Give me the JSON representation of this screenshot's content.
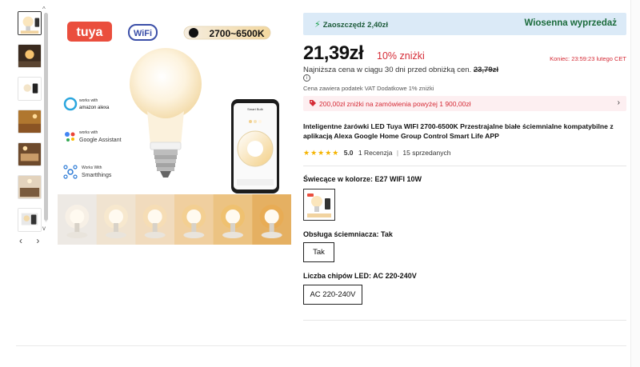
{
  "gallery": {
    "thumbnails": [
      "bulb-hero",
      "room-lamp",
      "bulb-app",
      "bedroom",
      "living-room",
      "kitchen",
      "bulb-app-2"
    ],
    "active_index": 0,
    "nav_prev": "‹",
    "nav_next": "›",
    "scroll_up": "^",
    "scroll_down": "v"
  },
  "main_image": {
    "brand_logo": "tuya",
    "wifi_badge": "WiFi",
    "temperature_range": "2700~6500K",
    "works_with_alexa_small": "works with",
    "works_with_alexa_big": "amazon alexa",
    "works_with_google_small": "works with",
    "works_with_google_big": "Google Assistant",
    "works_with_st_small": "Works With",
    "works_with_st_big": "Smartthings",
    "phone_header": "Smart Bulb",
    "bulb_colors": [
      "#fff6e8",
      "#fdeccc",
      "#f9dfae",
      "#f6cf86",
      "#f2bf63",
      "#eba94a"
    ],
    "strip_colors": [
      "#ede9e4",
      "#f0e3d0",
      "#f1dbbd",
      "#f0cf9f",
      "#ecc382",
      "#e5b062"
    ]
  },
  "price_block": {
    "save_label": "Zaoszczędź 2,40zł",
    "sale_label": "Wiosenna wyprzedaż",
    "price": "21,39zł",
    "discount": "10% zniżki",
    "ends": "Koniec: 23:59:23 lutego CET",
    "lowest_price_prefix": "Najniższa cena w ciągu 30 dni przed obniżką cen.",
    "lowest_price_value": "23,79zł",
    "info_icon": "i",
    "vat_note": "Cena zawiera podatek VAT Dodatkowe 1% zniżki",
    "promo_text": "200,00zł zniżki na zamówienia powyżej 1 900,00zł",
    "promo_chevron": "›"
  },
  "product": {
    "title": "Inteligentne żarówki LED Tuya WIFI 2700-6500K Przestrajalne białe ściemnialne kompatybilne z aplikacją Alexa Google Home Group Control Smart Life APP",
    "stars": "★★★★★",
    "rating": "5.0",
    "reviews": "1 Recenzja",
    "sold": "15 sprzedanych",
    "separator": "|"
  },
  "options": {
    "color_label": "Świecące w kolorze: E27 WIFI 10W",
    "dimmer_label": "Obsługa ściemniacza: Tak",
    "dimmer_value": "Tak",
    "chips_label": "Liczba chipów LED: AC 220-240V",
    "chips_value": "AC 220-240V"
  },
  "colors": {
    "accent_red": "#d52b36",
    "save_bar_bg": "#dbeaf7",
    "sale_green": "#1b6b3c",
    "star_yellow": "#f5b400"
  }
}
